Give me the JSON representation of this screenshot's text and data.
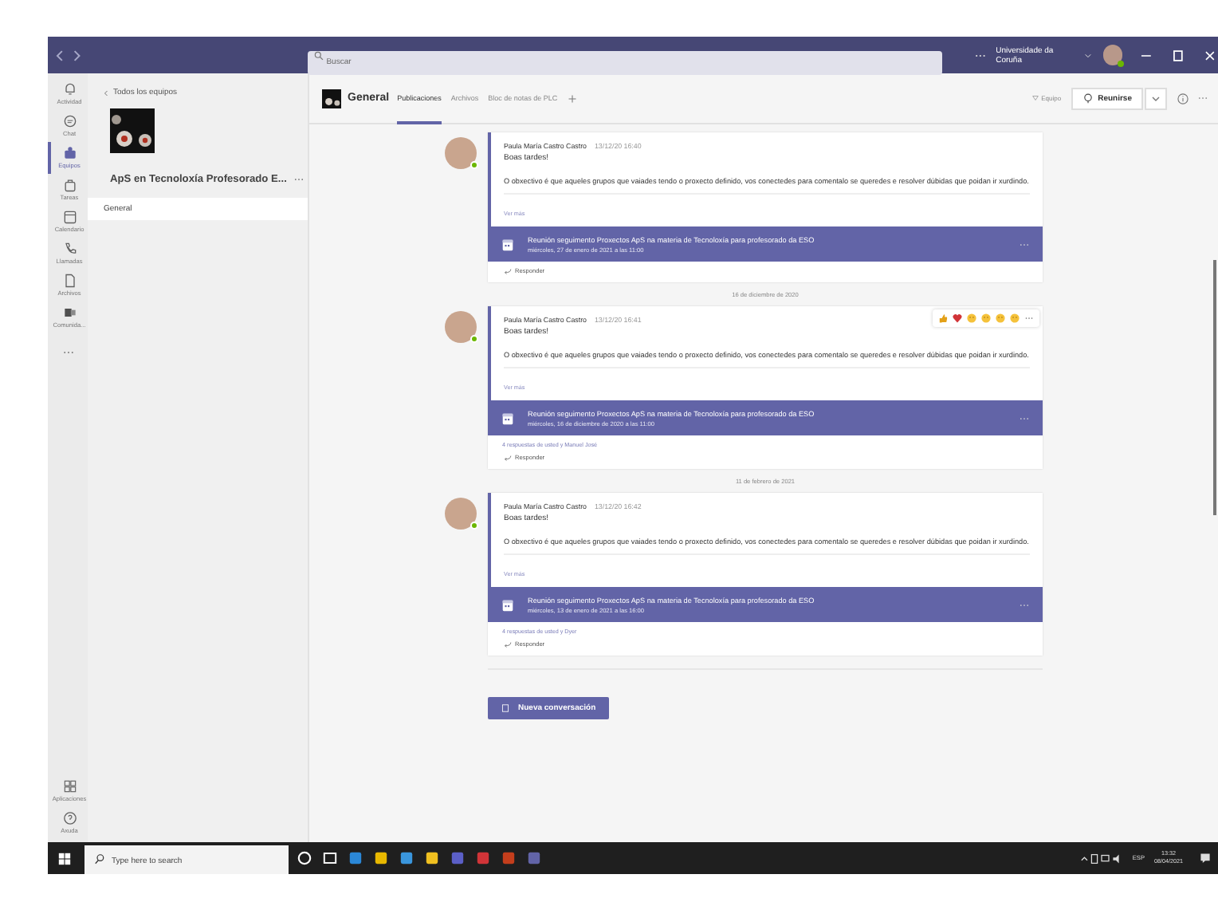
{
  "title_bar": {
    "search_placeholder": "Buscar",
    "organization": "Universidade da Coruña"
  },
  "app_bar": {
    "items": [
      {
        "label": "Actividad",
        "selected": false
      },
      {
        "label": "Chat",
        "selected": false
      },
      {
        "label": "Equipos",
        "selected": true
      },
      {
        "label": "Tareas",
        "selected": false
      },
      {
        "label": "Calendario",
        "selected": false
      },
      {
        "label": "Llamadas",
        "selected": false
      },
      {
        "label": "Archivos",
        "selected": false
      },
      {
        "label": "Comunida...",
        "selected": false
      }
    ],
    "bottom_items": [
      {
        "label": "Aplicaciones",
        "selected": false
      },
      {
        "label": "Axuda",
        "selected": false
      }
    ]
  },
  "team_panel": {
    "back_link": "Todos los equipos",
    "team_name": "ApS en Tecnoloxía Profesorado E...",
    "channels": [
      {
        "label": "General",
        "selected": true
      }
    ]
  },
  "channel_header": {
    "title": "General",
    "tabs": [
      {
        "label": "Publicaciones",
        "selected": true
      },
      {
        "label": "Archivos",
        "selected": false
      },
      {
        "label": "Bloc de notas de PLC",
        "selected": false
      }
    ],
    "team_button": "Equipo",
    "meet_button": "Reunirse"
  },
  "feed": [
    {
      "kind": "post",
      "author": "Paula María Castro Castro",
      "online": true,
      "time": "13/12/20 16:40",
      "greeting": "Boas tardes!",
      "body": "O obxectivo é que aqueles grupos que vaiades tendo o proxecto definido, vos conectedes para comentalo se queredes e resolver dúbidas que poidan ir xurdindo.",
      "more_link": "Ver más",
      "meeting_title": "Reunión seguimento Proxectos ApS na materia de Tecnoloxía para profesorado da ESO",
      "meeting_date": "miércoles, 27 de enero de 2021 a las 11:00",
      "reply_button": "Responder",
      "hovered": false
    },
    {
      "kind": "date",
      "text": "16 de diciembre de 2020"
    },
    {
      "kind": "post",
      "author": "Paula María Castro Castro",
      "online": true,
      "time": "13/12/20 16:41",
      "greeting": "Boas tardes!",
      "body": "O obxectivo é que aqueles grupos que vaiades tendo o proxecto definido, vos conectedes para comentalo se queredes e resolver dúbidas que poidan ir xurdindo.",
      "more_link": "Ver más",
      "meeting_title": "Reunión seguimento Proxectos ApS na materia de Tecnoloxía para profesorado da ESO",
      "meeting_date": "miércoles, 16 de diciembre de 2020 a las 11:00",
      "replies": "4 respuestas de usted y Manuel José",
      "reply_button": "Responder",
      "hovered": true
    },
    {
      "kind": "date",
      "text": "11 de febrero de 2021"
    },
    {
      "kind": "post",
      "author": "Paula María Castro Castro",
      "online": true,
      "time": "13/12/20 16:42",
      "greeting": "Boas tardes!",
      "body": "O obxectivo é que aqueles grupos que vaiades tendo o proxecto definido, vos conectedes para comentalo se queredes e resolver dúbidas que poidan ir xurdindo.",
      "more_link": "Ver más",
      "meeting_title": "Reunión seguimento Proxectos ApS na materia de Tecnoloxía para profesorado da ESO",
      "meeting_date": "miércoles, 13 de enero de 2021 a las 16:00",
      "replies": "4 respuestas de usted y Dyer",
      "reply_button": "Responder",
      "hovered": false
    }
  ],
  "new_conversation_button": "Nueva conversación",
  "taskbar": {
    "search_placeholder": "Type here to search",
    "language": "ESP",
    "time": "13:32",
    "date": "08/04/2021"
  }
}
